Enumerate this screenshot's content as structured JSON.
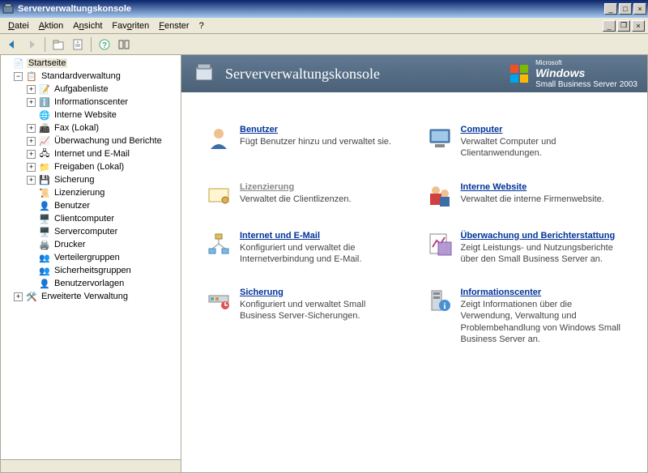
{
  "window": {
    "title": "Serververwaltungskonsole"
  },
  "menu": {
    "datei": "Datei",
    "aktion": "Aktion",
    "ansicht": "Ansicht",
    "favoriten": "Favoriten",
    "fenster": "Fenster",
    "help": "?"
  },
  "tree": {
    "root": "Startseite",
    "std": "Standardverwaltung",
    "aufgaben": "Aufgabenliste",
    "info": "Informationscenter",
    "website": "Interne Website",
    "fax": "Fax (Lokal)",
    "ueberwachung": "Überwachung und Berichte",
    "internet": "Internet und E-Mail",
    "freigaben": "Freigaben (Lokal)",
    "sicherung": "Sicherung",
    "lizenz": "Lizenzierung",
    "benutzer": "Benutzer",
    "client": "Clientcomputer",
    "server": "Servercomputer",
    "drucker": "Drucker",
    "verteiler": "Verteilergruppen",
    "sicherheit": "Sicherheitsgruppen",
    "vorlagen": "Benutzervorlagen",
    "erweitert": "Erweiterte Verwaltung"
  },
  "header": {
    "title": "Serververwaltungskonsole",
    "ms": "Microsoft",
    "win": "Windows",
    "sbs": "Small Business Server",
    "year": "2003"
  },
  "tiles": {
    "benutzer": {
      "title": "Benutzer",
      "desc": "Fügt Benutzer hinzu und verwaltet sie."
    },
    "computer": {
      "title": "Computer",
      "desc": "Verwaltet Computer und Clientanwendungen."
    },
    "lizenz": {
      "title": "Lizenzierung",
      "desc": "Verwaltet die Clientlizenzen."
    },
    "website": {
      "title": "Interne Website",
      "desc": "Verwaltet die interne Firmenwebsite."
    },
    "internet": {
      "title": "Internet und E-Mail",
      "desc": "Konfiguriert und verwaltet die Internetverbindung und E-Mail."
    },
    "report": {
      "title": "Überwachung und Berichterstattung",
      "desc": "Zeigt Leistungs- und Nutzungsberichte über den Small Business Server an."
    },
    "sicherung": {
      "title": "Sicherung",
      "desc": "Konfiguriert und verwaltet Small Business Server-Sicherungen."
    },
    "infocenter": {
      "title": "Informationscenter",
      "desc": "Zeigt Informationen über die Verwendung, Verwaltung und Problembehandlung von Windows Small Business Server an."
    }
  }
}
